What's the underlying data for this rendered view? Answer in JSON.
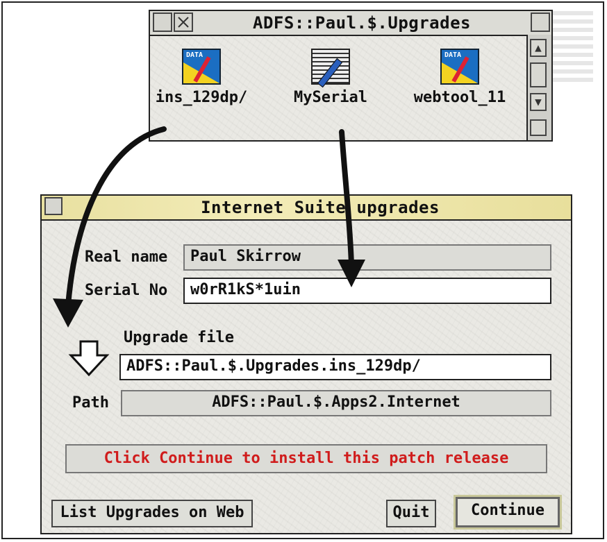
{
  "filer": {
    "title": "ADFS::Paul.$.Upgrades",
    "files": [
      {
        "name": "ins_129dp/",
        "icon": "data-file-icon"
      },
      {
        "name": "MySerial",
        "icon": "text-file-icon"
      },
      {
        "name": "webtool_11",
        "icon": "data-file-icon"
      }
    ]
  },
  "dialog": {
    "title": "Internet Suite upgrades",
    "real_name_label": "Real name",
    "real_name_value": "Paul Skirrow",
    "serial_label": "Serial No",
    "serial_value": "w0rR1kS*1uin",
    "upgrade_file_label": "Upgrade file",
    "upgrade_file_value": "ADFS::Paul.$.Upgrades.ins_129dp/",
    "path_label": "Path",
    "path_value": "ADFS::Paul.$.Apps2.Internet",
    "status": "Click Continue to install this patch release",
    "buttons": {
      "list": "List Upgrades on Web",
      "quit": "Quit",
      "continue": "Continue"
    }
  },
  "colors": {
    "status_text": "#d01c1c",
    "window_bg": "#eae9e4",
    "arrow": "#111111"
  }
}
